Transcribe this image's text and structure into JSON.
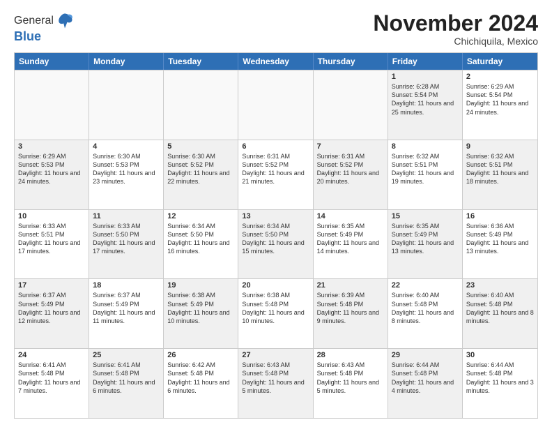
{
  "header": {
    "logo_line1": "General",
    "logo_line2": "Blue",
    "month_title": "November 2024",
    "subtitle": "Chichiquila, Mexico"
  },
  "weekdays": [
    "Sunday",
    "Monday",
    "Tuesday",
    "Wednesday",
    "Thursday",
    "Friday",
    "Saturday"
  ],
  "rows": [
    [
      {
        "day": "",
        "text": "",
        "empty": true
      },
      {
        "day": "",
        "text": "",
        "empty": true
      },
      {
        "day": "",
        "text": "",
        "empty": true
      },
      {
        "day": "",
        "text": "",
        "empty": true
      },
      {
        "day": "",
        "text": "",
        "empty": true
      },
      {
        "day": "1",
        "text": "Sunrise: 6:28 AM\nSunset: 5:54 PM\nDaylight: 11 hours and 25 minutes.",
        "shaded": true
      },
      {
        "day": "2",
        "text": "Sunrise: 6:29 AM\nSunset: 5:54 PM\nDaylight: 11 hours and 24 minutes.",
        "shaded": false
      }
    ],
    [
      {
        "day": "3",
        "text": "Sunrise: 6:29 AM\nSunset: 5:53 PM\nDaylight: 11 hours and 24 minutes.",
        "shaded": true
      },
      {
        "day": "4",
        "text": "Sunrise: 6:30 AM\nSunset: 5:53 PM\nDaylight: 11 hours and 23 minutes.",
        "shaded": false
      },
      {
        "day": "5",
        "text": "Sunrise: 6:30 AM\nSunset: 5:52 PM\nDaylight: 11 hours and 22 minutes.",
        "shaded": true
      },
      {
        "day": "6",
        "text": "Sunrise: 6:31 AM\nSunset: 5:52 PM\nDaylight: 11 hours and 21 minutes.",
        "shaded": false
      },
      {
        "day": "7",
        "text": "Sunrise: 6:31 AM\nSunset: 5:52 PM\nDaylight: 11 hours and 20 minutes.",
        "shaded": true
      },
      {
        "day": "8",
        "text": "Sunrise: 6:32 AM\nSunset: 5:51 PM\nDaylight: 11 hours and 19 minutes.",
        "shaded": false
      },
      {
        "day": "9",
        "text": "Sunrise: 6:32 AM\nSunset: 5:51 PM\nDaylight: 11 hours and 18 minutes.",
        "shaded": true
      }
    ],
    [
      {
        "day": "10",
        "text": "Sunrise: 6:33 AM\nSunset: 5:51 PM\nDaylight: 11 hours and 17 minutes.",
        "shaded": false
      },
      {
        "day": "11",
        "text": "Sunrise: 6:33 AM\nSunset: 5:50 PM\nDaylight: 11 hours and 17 minutes.",
        "shaded": true
      },
      {
        "day": "12",
        "text": "Sunrise: 6:34 AM\nSunset: 5:50 PM\nDaylight: 11 hours and 16 minutes.",
        "shaded": false
      },
      {
        "day": "13",
        "text": "Sunrise: 6:34 AM\nSunset: 5:50 PM\nDaylight: 11 hours and 15 minutes.",
        "shaded": true
      },
      {
        "day": "14",
        "text": "Sunrise: 6:35 AM\nSunset: 5:49 PM\nDaylight: 11 hours and 14 minutes.",
        "shaded": false
      },
      {
        "day": "15",
        "text": "Sunrise: 6:35 AM\nSunset: 5:49 PM\nDaylight: 11 hours and 13 minutes.",
        "shaded": true
      },
      {
        "day": "16",
        "text": "Sunrise: 6:36 AM\nSunset: 5:49 PM\nDaylight: 11 hours and 13 minutes.",
        "shaded": false
      }
    ],
    [
      {
        "day": "17",
        "text": "Sunrise: 6:37 AM\nSunset: 5:49 PM\nDaylight: 11 hours and 12 minutes.",
        "shaded": true
      },
      {
        "day": "18",
        "text": "Sunrise: 6:37 AM\nSunset: 5:49 PM\nDaylight: 11 hours and 11 minutes.",
        "shaded": false
      },
      {
        "day": "19",
        "text": "Sunrise: 6:38 AM\nSunset: 5:49 PM\nDaylight: 11 hours and 10 minutes.",
        "shaded": true
      },
      {
        "day": "20",
        "text": "Sunrise: 6:38 AM\nSunset: 5:48 PM\nDaylight: 11 hours and 10 minutes.",
        "shaded": false
      },
      {
        "day": "21",
        "text": "Sunrise: 6:39 AM\nSunset: 5:48 PM\nDaylight: 11 hours and 9 minutes.",
        "shaded": true
      },
      {
        "day": "22",
        "text": "Sunrise: 6:40 AM\nSunset: 5:48 PM\nDaylight: 11 hours and 8 minutes.",
        "shaded": false
      },
      {
        "day": "23",
        "text": "Sunrise: 6:40 AM\nSunset: 5:48 PM\nDaylight: 11 hours and 8 minutes.",
        "shaded": true
      }
    ],
    [
      {
        "day": "24",
        "text": "Sunrise: 6:41 AM\nSunset: 5:48 PM\nDaylight: 11 hours and 7 minutes.",
        "shaded": false
      },
      {
        "day": "25",
        "text": "Sunrise: 6:41 AM\nSunset: 5:48 PM\nDaylight: 11 hours and 6 minutes.",
        "shaded": true
      },
      {
        "day": "26",
        "text": "Sunrise: 6:42 AM\nSunset: 5:48 PM\nDaylight: 11 hours and 6 minutes.",
        "shaded": false
      },
      {
        "day": "27",
        "text": "Sunrise: 6:43 AM\nSunset: 5:48 PM\nDaylight: 11 hours and 5 minutes.",
        "shaded": true
      },
      {
        "day": "28",
        "text": "Sunrise: 6:43 AM\nSunset: 5:48 PM\nDaylight: 11 hours and 5 minutes.",
        "shaded": false
      },
      {
        "day": "29",
        "text": "Sunrise: 6:44 AM\nSunset: 5:48 PM\nDaylight: 11 hours and 4 minutes.",
        "shaded": true
      },
      {
        "day": "30",
        "text": "Sunrise: 6:44 AM\nSunset: 5:48 PM\nDaylight: 11 hours and 3 minutes.",
        "shaded": false
      }
    ]
  ]
}
